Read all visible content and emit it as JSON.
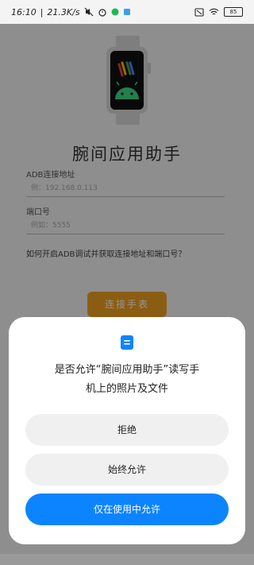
{
  "status_bar": {
    "time": "16:10",
    "speed": "21.3K/s",
    "battery": "85"
  },
  "app": {
    "title": "腕间应用助手",
    "adb_label": "ADB连接地址",
    "adb_placeholder": "例：192.168.0.113",
    "port_label": "端口号",
    "port_placeholder": "例如：5555",
    "help_text": "如何开启ADB调试并获取连接地址和端口号？",
    "connect_button": "连接手表"
  },
  "permission_dialog": {
    "message_line1": "是否允许“腕间应用助手”读写手",
    "message_line2": "机上的照片及文件",
    "deny_button": "拒绝",
    "always_allow_button": "始终允许",
    "allow_while_using_button": "仅在使用中允许"
  },
  "colors": {
    "accent": "#0d84ff",
    "connect_button": "#f0a020"
  }
}
